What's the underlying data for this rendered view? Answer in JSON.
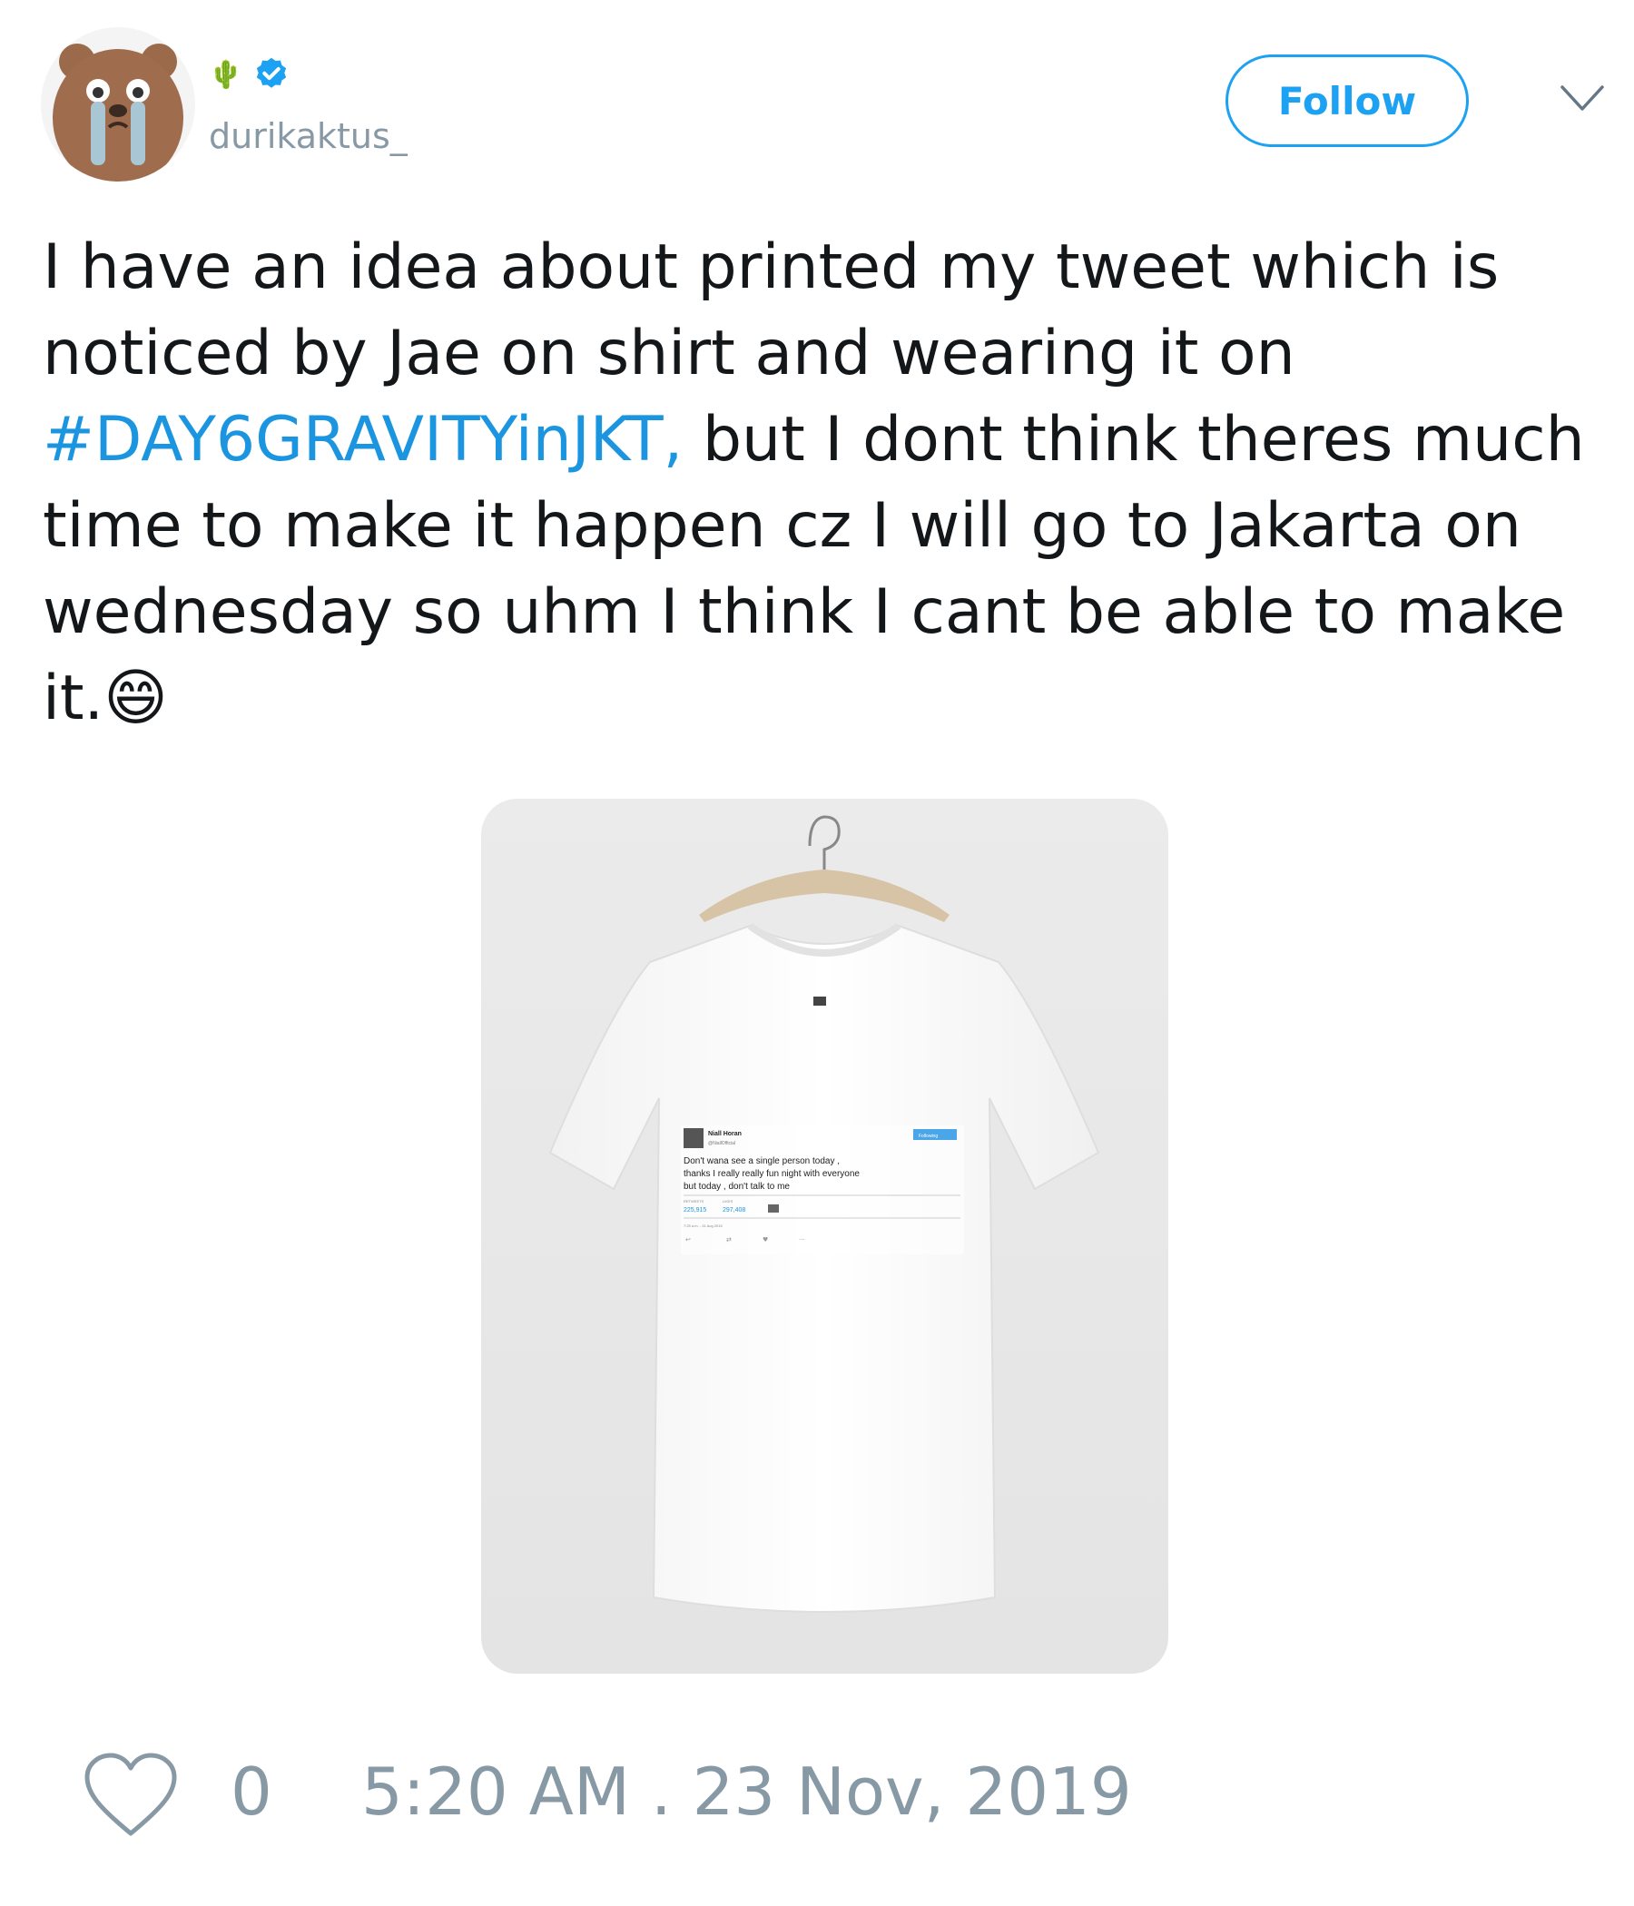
{
  "user": {
    "name_emoji": "🌵",
    "handle": "durikaktus_",
    "verified": true,
    "avatar_icon": "crying-bear-avatar"
  },
  "header": {
    "follow_label": "Follow",
    "menu_icon": "chevron-down-icon"
  },
  "tweet": {
    "text_before": "I have an idea about printed my tweet which is noticed by Jae on shirt and wearing it on ",
    "hashtag": "#DAY6GRAVITYinJKT,",
    "text_after": " but I dont think theres much time to make it happen cz I will go to Jakarta on wednesday so uhm I think I cant be able to make it.😄"
  },
  "media": {
    "printed_tweet": {
      "name": "Niall Horan",
      "handle": "@NiallOfficial",
      "follow_label": "Following",
      "text": "Don't wana see a single person today , thanks I really really fun night with everyone but today , don't talk to me",
      "retweets_label": "RETWEETS",
      "likes_label": "LIKES",
      "retweets": "225,915",
      "likes": "297,408",
      "timestamp": "7:25 a.m. - 31 Aug 2015"
    }
  },
  "actions": {
    "like_count": "0",
    "timestamp": "5:20 AM . 23 Nov, 2019"
  },
  "colors": {
    "accent": "#1da1f2",
    "hashtag": "#1b95e0",
    "muted": "#8899a6",
    "text": "#14171a"
  }
}
